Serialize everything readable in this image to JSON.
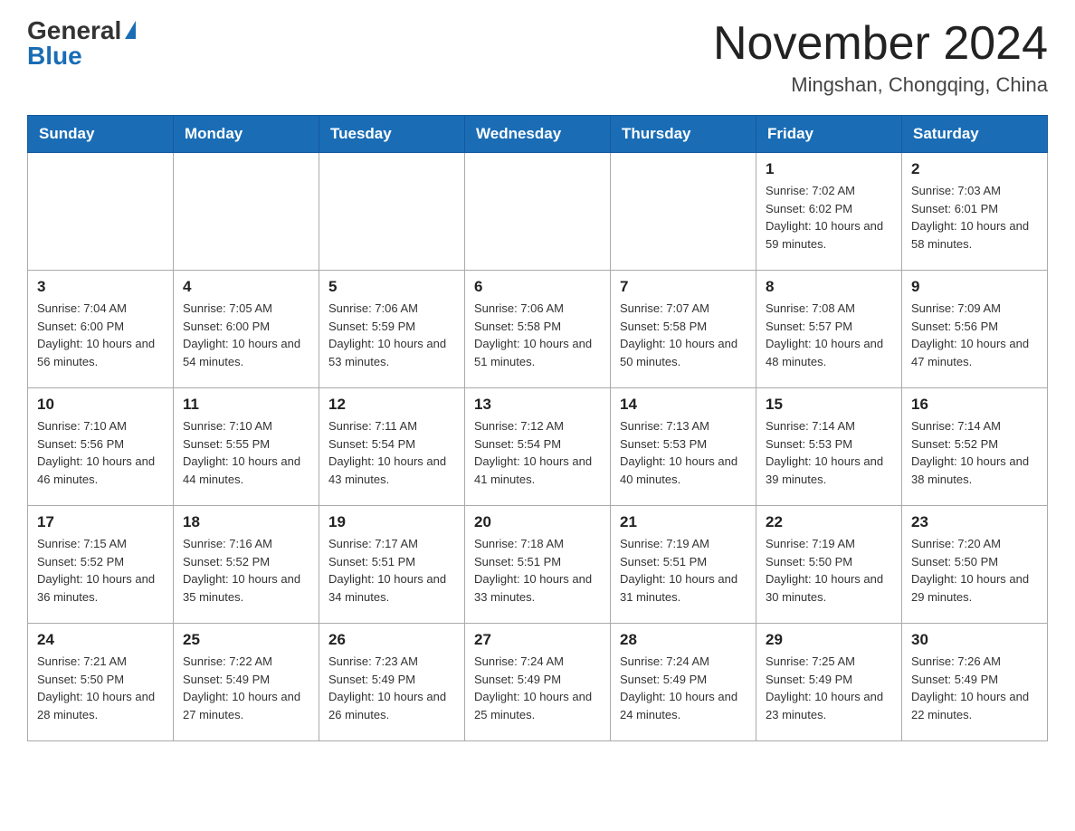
{
  "logo": {
    "general": "General",
    "blue": "Blue"
  },
  "header": {
    "title": "November 2024",
    "subtitle": "Mingshan, Chongqing, China"
  },
  "days_of_week": [
    "Sunday",
    "Monday",
    "Tuesday",
    "Wednesday",
    "Thursday",
    "Friday",
    "Saturday"
  ],
  "weeks": [
    [
      {
        "day": "",
        "sunrise": "",
        "sunset": "",
        "daylight": ""
      },
      {
        "day": "",
        "sunrise": "",
        "sunset": "",
        "daylight": ""
      },
      {
        "day": "",
        "sunrise": "",
        "sunset": "",
        "daylight": ""
      },
      {
        "day": "",
        "sunrise": "",
        "sunset": "",
        "daylight": ""
      },
      {
        "day": "",
        "sunrise": "",
        "sunset": "",
        "daylight": ""
      },
      {
        "day": "1",
        "sunrise": "Sunrise: 7:02 AM",
        "sunset": "Sunset: 6:02 PM",
        "daylight": "Daylight: 10 hours and 59 minutes."
      },
      {
        "day": "2",
        "sunrise": "Sunrise: 7:03 AM",
        "sunset": "Sunset: 6:01 PM",
        "daylight": "Daylight: 10 hours and 58 minutes."
      }
    ],
    [
      {
        "day": "3",
        "sunrise": "Sunrise: 7:04 AM",
        "sunset": "Sunset: 6:00 PM",
        "daylight": "Daylight: 10 hours and 56 minutes."
      },
      {
        "day": "4",
        "sunrise": "Sunrise: 7:05 AM",
        "sunset": "Sunset: 6:00 PM",
        "daylight": "Daylight: 10 hours and 54 minutes."
      },
      {
        "day": "5",
        "sunrise": "Sunrise: 7:06 AM",
        "sunset": "Sunset: 5:59 PM",
        "daylight": "Daylight: 10 hours and 53 minutes."
      },
      {
        "day": "6",
        "sunrise": "Sunrise: 7:06 AM",
        "sunset": "Sunset: 5:58 PM",
        "daylight": "Daylight: 10 hours and 51 minutes."
      },
      {
        "day": "7",
        "sunrise": "Sunrise: 7:07 AM",
        "sunset": "Sunset: 5:58 PM",
        "daylight": "Daylight: 10 hours and 50 minutes."
      },
      {
        "day": "8",
        "sunrise": "Sunrise: 7:08 AM",
        "sunset": "Sunset: 5:57 PM",
        "daylight": "Daylight: 10 hours and 48 minutes."
      },
      {
        "day": "9",
        "sunrise": "Sunrise: 7:09 AM",
        "sunset": "Sunset: 5:56 PM",
        "daylight": "Daylight: 10 hours and 47 minutes."
      }
    ],
    [
      {
        "day": "10",
        "sunrise": "Sunrise: 7:10 AM",
        "sunset": "Sunset: 5:56 PM",
        "daylight": "Daylight: 10 hours and 46 minutes."
      },
      {
        "day": "11",
        "sunrise": "Sunrise: 7:10 AM",
        "sunset": "Sunset: 5:55 PM",
        "daylight": "Daylight: 10 hours and 44 minutes."
      },
      {
        "day": "12",
        "sunrise": "Sunrise: 7:11 AM",
        "sunset": "Sunset: 5:54 PM",
        "daylight": "Daylight: 10 hours and 43 minutes."
      },
      {
        "day": "13",
        "sunrise": "Sunrise: 7:12 AM",
        "sunset": "Sunset: 5:54 PM",
        "daylight": "Daylight: 10 hours and 41 minutes."
      },
      {
        "day": "14",
        "sunrise": "Sunrise: 7:13 AM",
        "sunset": "Sunset: 5:53 PM",
        "daylight": "Daylight: 10 hours and 40 minutes."
      },
      {
        "day": "15",
        "sunrise": "Sunrise: 7:14 AM",
        "sunset": "Sunset: 5:53 PM",
        "daylight": "Daylight: 10 hours and 39 minutes."
      },
      {
        "day": "16",
        "sunrise": "Sunrise: 7:14 AM",
        "sunset": "Sunset: 5:52 PM",
        "daylight": "Daylight: 10 hours and 38 minutes."
      }
    ],
    [
      {
        "day": "17",
        "sunrise": "Sunrise: 7:15 AM",
        "sunset": "Sunset: 5:52 PM",
        "daylight": "Daylight: 10 hours and 36 minutes."
      },
      {
        "day": "18",
        "sunrise": "Sunrise: 7:16 AM",
        "sunset": "Sunset: 5:52 PM",
        "daylight": "Daylight: 10 hours and 35 minutes."
      },
      {
        "day": "19",
        "sunrise": "Sunrise: 7:17 AM",
        "sunset": "Sunset: 5:51 PM",
        "daylight": "Daylight: 10 hours and 34 minutes."
      },
      {
        "day": "20",
        "sunrise": "Sunrise: 7:18 AM",
        "sunset": "Sunset: 5:51 PM",
        "daylight": "Daylight: 10 hours and 33 minutes."
      },
      {
        "day": "21",
        "sunrise": "Sunrise: 7:19 AM",
        "sunset": "Sunset: 5:51 PM",
        "daylight": "Daylight: 10 hours and 31 minutes."
      },
      {
        "day": "22",
        "sunrise": "Sunrise: 7:19 AM",
        "sunset": "Sunset: 5:50 PM",
        "daylight": "Daylight: 10 hours and 30 minutes."
      },
      {
        "day": "23",
        "sunrise": "Sunrise: 7:20 AM",
        "sunset": "Sunset: 5:50 PM",
        "daylight": "Daylight: 10 hours and 29 minutes."
      }
    ],
    [
      {
        "day": "24",
        "sunrise": "Sunrise: 7:21 AM",
        "sunset": "Sunset: 5:50 PM",
        "daylight": "Daylight: 10 hours and 28 minutes."
      },
      {
        "day": "25",
        "sunrise": "Sunrise: 7:22 AM",
        "sunset": "Sunset: 5:49 PM",
        "daylight": "Daylight: 10 hours and 27 minutes."
      },
      {
        "day": "26",
        "sunrise": "Sunrise: 7:23 AM",
        "sunset": "Sunset: 5:49 PM",
        "daylight": "Daylight: 10 hours and 26 minutes."
      },
      {
        "day": "27",
        "sunrise": "Sunrise: 7:24 AM",
        "sunset": "Sunset: 5:49 PM",
        "daylight": "Daylight: 10 hours and 25 minutes."
      },
      {
        "day": "28",
        "sunrise": "Sunrise: 7:24 AM",
        "sunset": "Sunset: 5:49 PM",
        "daylight": "Daylight: 10 hours and 24 minutes."
      },
      {
        "day": "29",
        "sunrise": "Sunrise: 7:25 AM",
        "sunset": "Sunset: 5:49 PM",
        "daylight": "Daylight: 10 hours and 23 minutes."
      },
      {
        "day": "30",
        "sunrise": "Sunrise: 7:26 AM",
        "sunset": "Sunset: 5:49 PM",
        "daylight": "Daylight: 10 hours and 22 minutes."
      }
    ]
  ]
}
